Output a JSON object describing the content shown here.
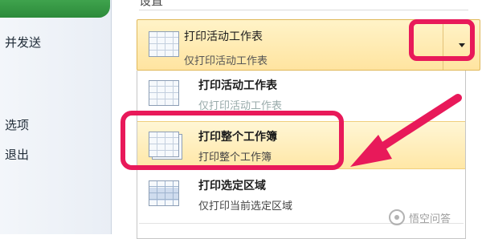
{
  "sidebar": {
    "items": [
      {
        "label": "并发送"
      },
      {
        "label": "选项"
      },
      {
        "label": "退出"
      }
    ]
  },
  "settings": {
    "heading": "设置"
  },
  "print_scope": {
    "selected": {
      "title": "打印活动工作表",
      "subtitle": "仅打印活动工作表"
    },
    "options": [
      {
        "title": "打印活动工作表",
        "subtitle": "仅打印活动工作表",
        "icon": "sheet-icon"
      },
      {
        "title": "打印整个工作簿",
        "subtitle": "打印整个工作簿",
        "icon": "workbook-icon"
      },
      {
        "title": "打印选定区域",
        "subtitle": "仅打印当前选定区域",
        "icon": "selection-icon"
      }
    ],
    "highlighted_index": 1
  },
  "annotation": {
    "color": "#e8195a"
  },
  "watermark": {
    "text": "悟空问答"
  }
}
